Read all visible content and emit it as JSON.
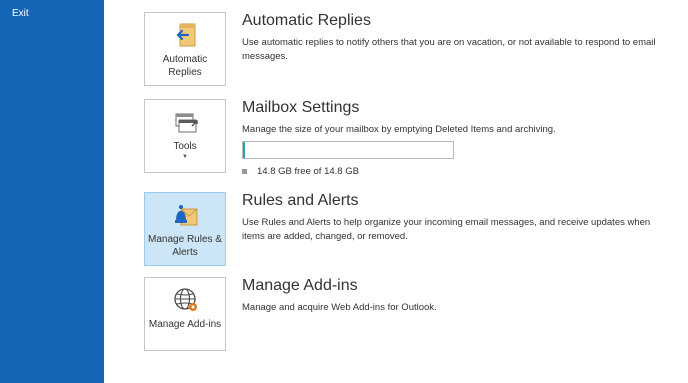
{
  "sidebar": {
    "exit_label": "Exit"
  },
  "sections": {
    "automatic_replies": {
      "tile_label": "Automatic Replies",
      "title": "Automatic Replies",
      "description": "Use automatic replies to notify others that you are on vacation, or not available to respond to email messages."
    },
    "mailbox_settings": {
      "tile_label": "Tools",
      "title": "Mailbox Settings",
      "description": "Manage the size of your mailbox by emptying Deleted Items and archiving.",
      "quota_text": "14.8 GB free of 14.8 GB",
      "quota_used_fraction": 0.01
    },
    "rules_alerts": {
      "tile_label": "Manage Rules & Alerts",
      "title": "Rules and Alerts",
      "description": "Use Rules and Alerts to help organize your incoming email messages, and receive updates when items are added, changed, or removed."
    },
    "addins": {
      "tile_label": "Manage Add-ins",
      "title": "Manage Add-ins",
      "description": "Manage and acquire Web Add-ins for Outlook."
    }
  },
  "colors": {
    "sidebar_bg": "#1565b6",
    "selected_tile_bg": "#cde6f7",
    "quota_fill": "#2aa3a3"
  },
  "icons": {
    "automatic_replies": "automatic-replies-icon",
    "tools": "tools-icon",
    "rules_alerts": "rules-alerts-icon",
    "addins": "addins-globe-icon"
  }
}
